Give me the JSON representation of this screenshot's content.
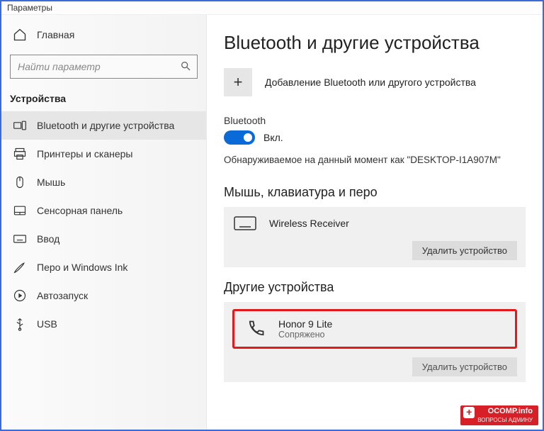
{
  "window": {
    "title": "Параметры"
  },
  "sidebar": {
    "home_label": "Главная",
    "search_placeholder": "Найти параметр",
    "section_label": "Устройства",
    "items": [
      {
        "label": "Bluetooth и другие устройства"
      },
      {
        "label": "Принтеры и сканеры"
      },
      {
        "label": "Мышь"
      },
      {
        "label": "Сенсорная панель"
      },
      {
        "label": "Ввод"
      },
      {
        "label": "Перо и Windows Ink"
      },
      {
        "label": "Автозапуск"
      },
      {
        "label": "USB"
      }
    ]
  },
  "page": {
    "title": "Bluetooth и другие устройства",
    "add_device_label": "Добавление Bluetooth или другого устройства",
    "bluetooth_label": "Bluetooth",
    "toggle_state_label": "Вкл.",
    "discoverable_text": "Обнаруживаемое на данный момент как \"DESKTOP-I1A907M\"",
    "sections": {
      "hid": {
        "title": "Мышь, клавиатура и перо",
        "device": {
          "name": "Wireless Receiver"
        },
        "remove_label": "Удалить устройство"
      },
      "other": {
        "title": "Другие устройства",
        "device": {
          "name": "Honor 9 Lite",
          "status": "Сопряжено"
        },
        "remove_label": "Удалить устройство"
      }
    }
  },
  "watermark": {
    "line1": "OCOMP.info",
    "line2": "ВОПРОСЫ АДМИНУ"
  }
}
